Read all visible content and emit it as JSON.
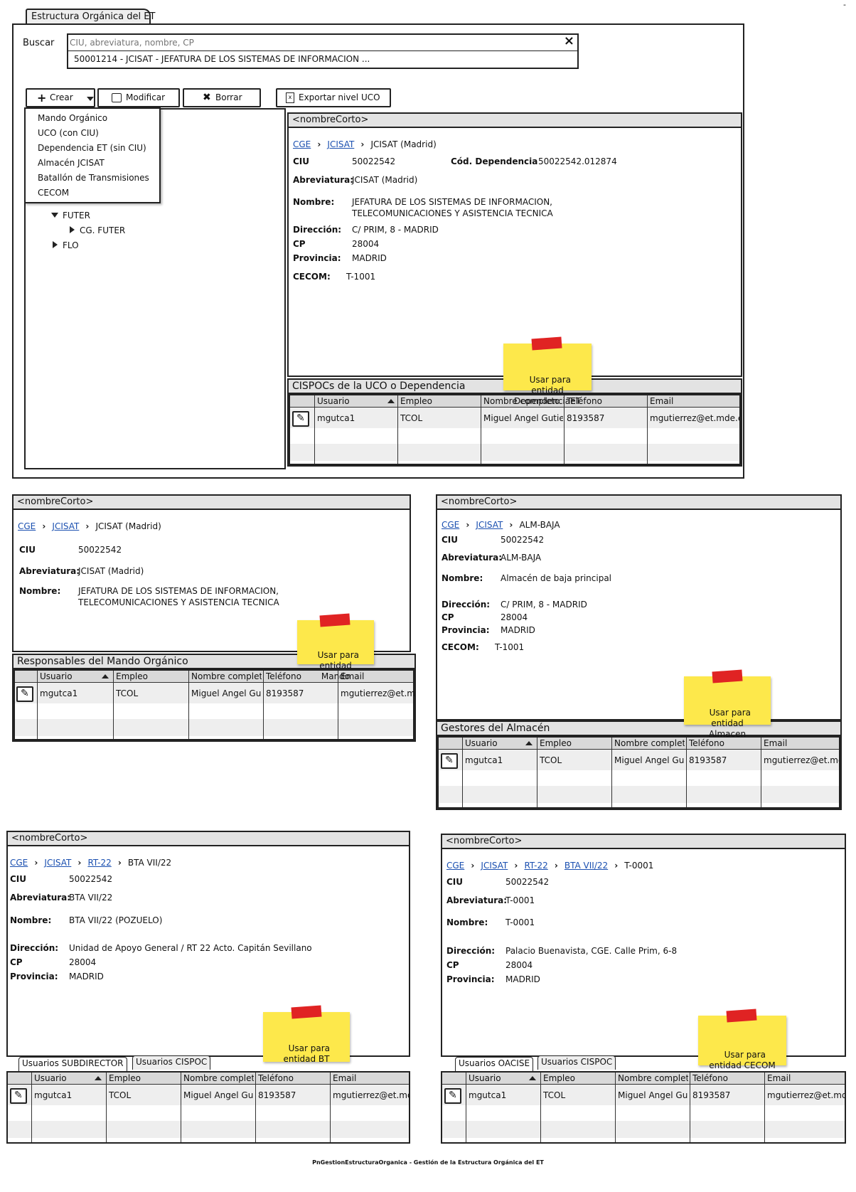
{
  "app": {
    "tab_title": "Estructura Orgánica del ET",
    "footer": "PnGestionEstructuraOrganica - Gestión de la Estructura Orgánica del ET",
    "corner_mark": "-"
  },
  "search": {
    "label": "Buscar",
    "placeholder": "CIU, abreviatura, nombre, CP",
    "close": "×",
    "result": "50001214 - JCISAT - JEFATURA DE LOS SISTEMAS DE INFORMACION ..."
  },
  "toolbar": {
    "crear": "Crear",
    "modificar": "Modificar",
    "borrar": "Borrar",
    "exportar": "Exportar nivel UCO"
  },
  "crear_menu": [
    "Mando Orgánico",
    "UCO (con CIU)",
    "Dependencia ET (sin CIU)",
    "Almacén JCISAT",
    "Batallón de Transmisiones",
    "CECOM"
  ],
  "tree": {
    "futer": "FUTER",
    "cg_futer": "CG. FUTER",
    "flo": "FLO"
  },
  "labels": {
    "ciu": "CIU",
    "cod_dep": "Cód. Dependencia",
    "abrev": "Abreviatura:",
    "nombre": "Nombre:",
    "direccion": "Dirección:",
    "cp": "CP",
    "provincia": "Provincia:",
    "cecom": "CECOM:"
  },
  "table_headers": {
    "usuario": "Usuario",
    "empleo": "Empleo",
    "nombre": "Nombre completo",
    "telefono": "Teléfono",
    "email": "Email"
  },
  "table_row": {
    "usuario": "mgutca1",
    "empleo": "TCOL",
    "nombre": "Miguel Angel Gutierrez",
    "telefono": "8193587",
    "email": "mgutierrez@et.mde.es"
  },
  "dep": {
    "title": "<nombreCorto>",
    "bc1": "CGE",
    "bc2": "JCISAT",
    "bc_current": "JCISAT (Madrid)",
    "ciu": "50022542",
    "cod_dep": "50022542.012874",
    "abrev": "JCISAT (Madrid)",
    "nombre1": "JEFATURA DE LOS SISTEMAS DE INFORMACION,",
    "nombre2": "TELECOMUNICACIONES Y ASISTENCIA TECNICA",
    "direccion": "C/ PRIM, 8 - MADRID",
    "cp": "28004",
    "provincia": "MADRID",
    "cecom": "T-1001",
    "table_title": "CISPOCs de la UCO o Dependencia",
    "sticky": "Usar para\nentidad\nDependenciaET"
  },
  "mando": {
    "title": "<nombreCorto>",
    "bc1": "CGE",
    "bc2": "JCISAT",
    "bc_current": "JCISAT (Madrid)",
    "ciu": "50022542",
    "abrev": "JCISAT (Madrid)",
    "nombre1": "JEFATURA DE LOS SISTEMAS DE INFORMACION,",
    "nombre2": "TELECOMUNICACIONES Y ASISTENCIA TECNICA",
    "table_title": "Responsables del Mando Orgánico",
    "sticky": "Usar para\nentidad\nMando"
  },
  "almacen": {
    "title": "<nombreCorto>",
    "bc1": "CGE",
    "bc2": "JCISAT",
    "bc_current": "ALM-BAJA",
    "ciu": "50022542",
    "abrev": "ALM-BAJA",
    "nombre": "Almacén de baja principal",
    "direccion": "C/ PRIM, 8 - MADRID",
    "cp": "28004",
    "provincia": "MADRID",
    "cecom": "T-1001",
    "table_title": "Gestores del Almacén",
    "sticky": "Usar para\nentidad\nAlmacen"
  },
  "bt": {
    "title": "<nombreCorto>",
    "bc1": "CGE",
    "bc2": "JCISAT",
    "bc3": "RT-22",
    "bc_current": "BTA VII/22",
    "ciu": "50022542",
    "abrev": "BTA VII/22",
    "nombre": "BTA VII/22 (POZUELO)",
    "direccion": "Unidad de Apoyo General / RT 22 Acto. Capitán Sevillano",
    "cp": "28004",
    "provincia": "MADRID",
    "tab1": "Usuarios SUBDIRECTOR",
    "tab2": "Usuarios CISPOC",
    "sticky": "Usar para\nentidad BT"
  },
  "cecom": {
    "title": "<nombreCorto>",
    "bc1": "CGE",
    "bc2": "JCISAT",
    "bc3": "RT-22",
    "bc4": "BTA VII/22",
    "bc_current": "T-0001",
    "ciu": "50022542",
    "abrev": "T-0001",
    "nombre": "T-0001",
    "direccion": "Palacio Buenavista, CGE. Calle Prim, 6-8",
    "cp": "28004",
    "provincia": "MADRID",
    "tab1": "Usuarios OACISE",
    "tab2": "Usuarios CISPOC",
    "sticky": "Usar para\nentidad CECOM"
  }
}
